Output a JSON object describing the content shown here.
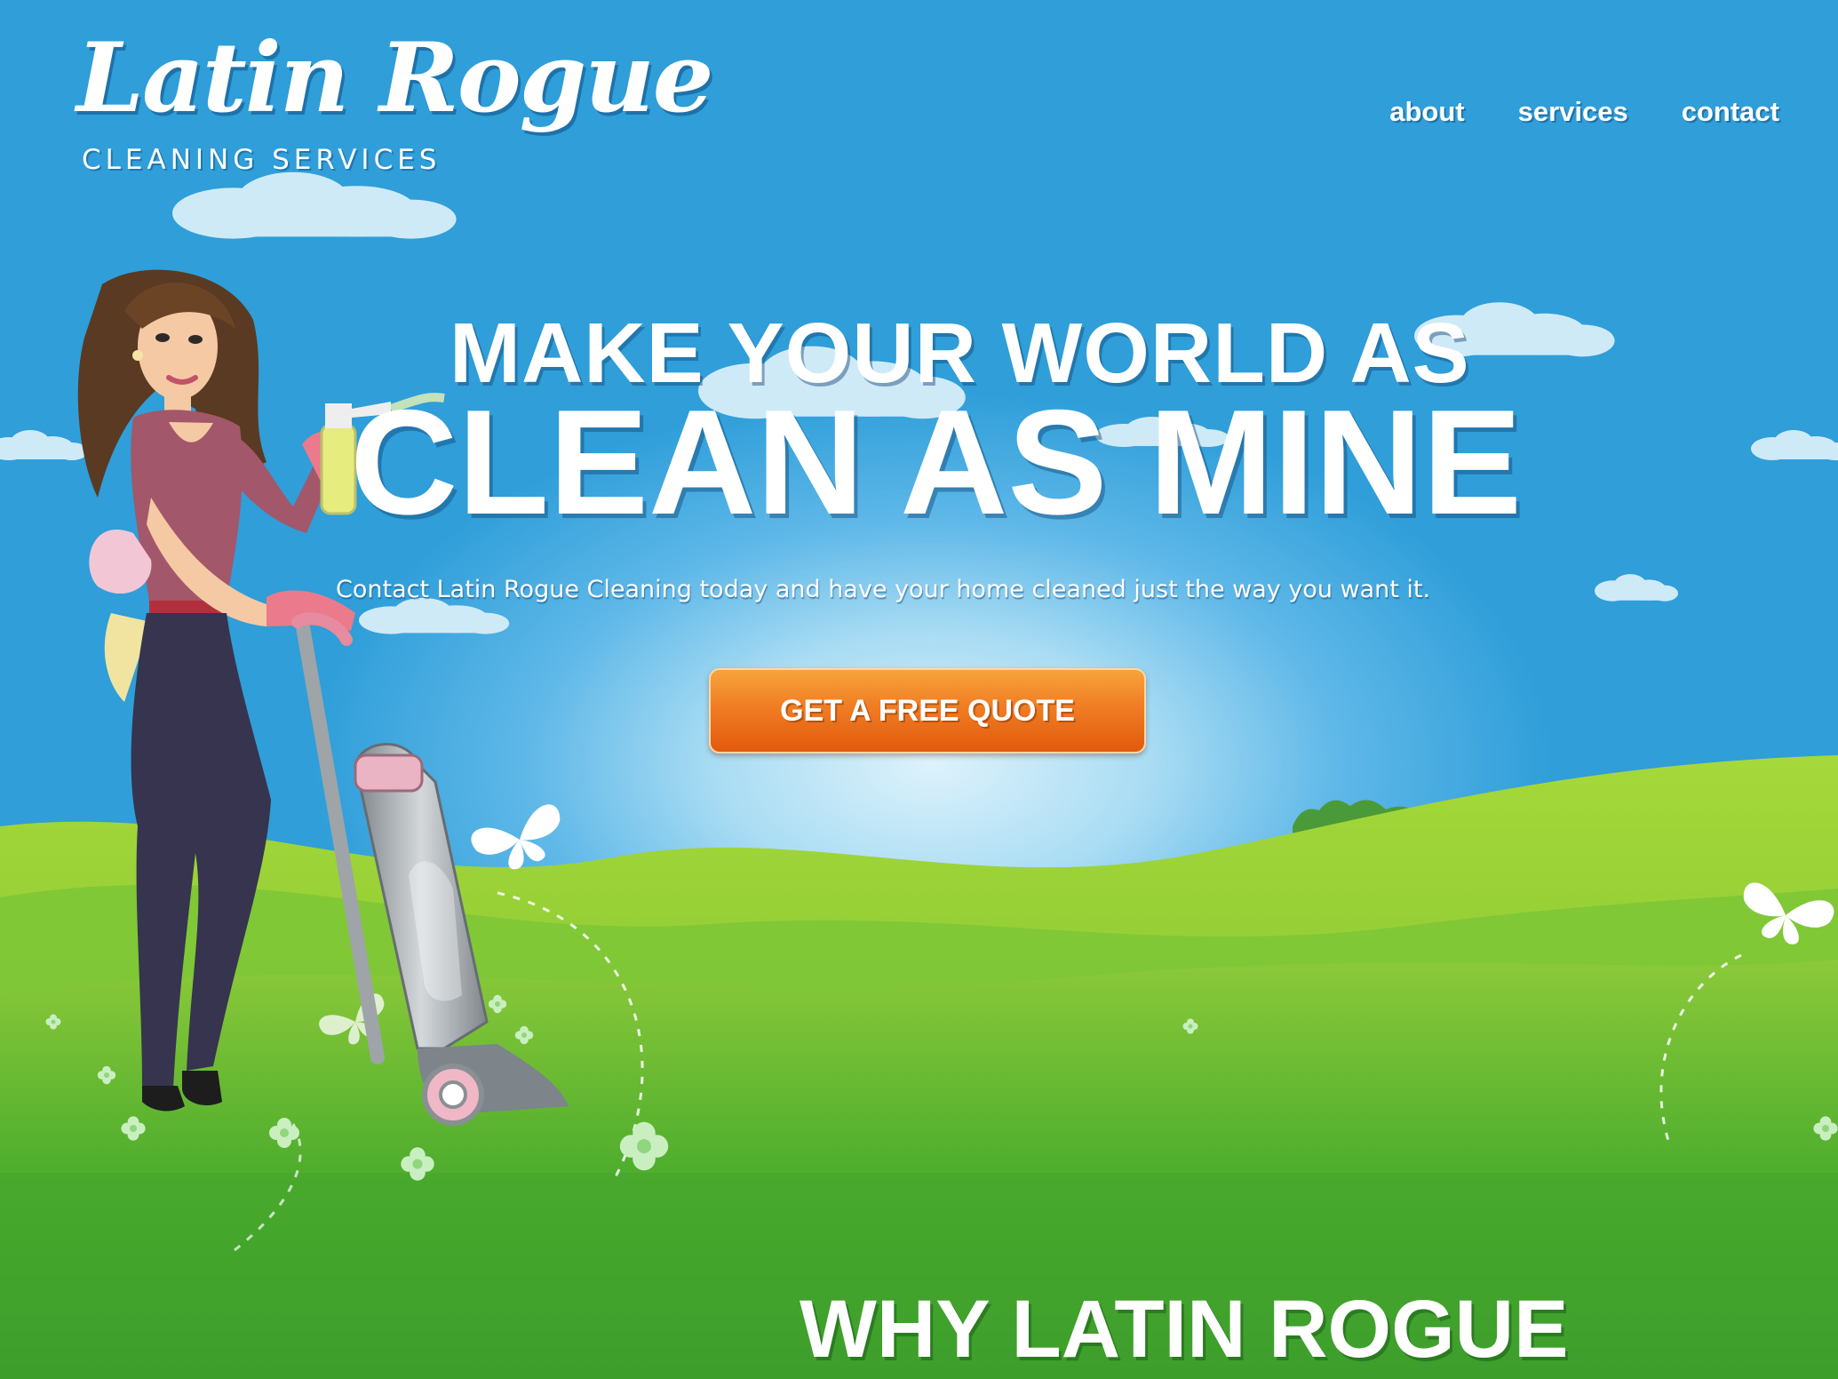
{
  "brand": {
    "script_name": "Latin Rogue",
    "tagline": "CLEANING SERVICES"
  },
  "nav": {
    "items": [
      {
        "label": "about"
      },
      {
        "label": "services"
      },
      {
        "label": "contact"
      }
    ]
  },
  "hero": {
    "headline_line1": "MAKE YOUR WORLD AS",
    "headline_line2": "CLEAN AS MINE",
    "subtitle": "Contact Latin Rogue Cleaning today and have your home cleaned just the way you want it.",
    "cta_label": "GET A FREE QUOTE"
  },
  "section": {
    "heading": "WHY LATIN ROGUE"
  },
  "colors": {
    "sky": "#2f9bd8",
    "grass": "#4caf2e",
    "cta_orange": "#f07d23",
    "text": "#ffffff"
  },
  "icons": [
    "butterfly-icon",
    "flower-icon",
    "cloud-icon"
  ]
}
